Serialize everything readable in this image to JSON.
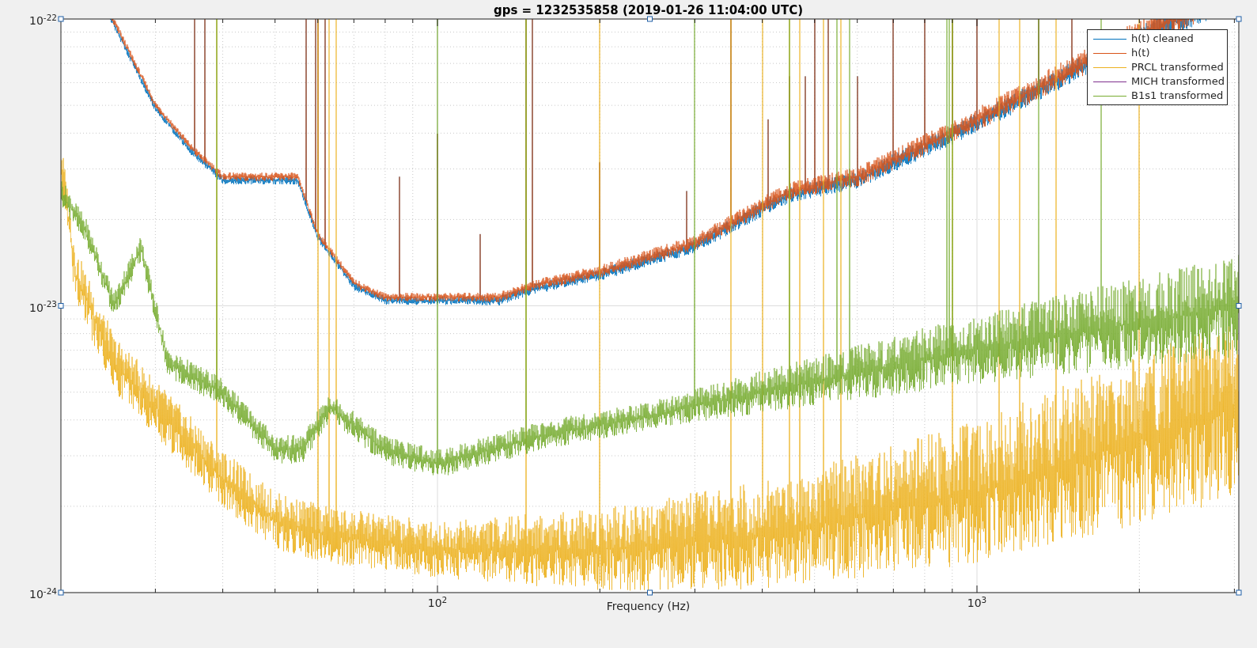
{
  "figure": {
    "title": "gps = 1232535858 (2019-01-26 11:04:00 UTC)",
    "xlabel": "Frequency (Hz)",
    "yticks": [
      "10$^{-22}$",
      "10$^{-23}$",
      "10$^{-24}$"
    ],
    "xticks": [
      "10$^{2}$",
      "10$^{3}$"
    ],
    "legend": [
      {
        "label": "h(t) cleaned",
        "color": "#0072bd"
      },
      {
        "label": "h(t)",
        "color": "#d95319"
      },
      {
        "label": "PRCL transformed",
        "color": "#edb120"
      },
      {
        "label": "MICH transformed",
        "color": "#7e2f8e"
      },
      {
        "label": "B1s1 transformed",
        "color": "#77ac30"
      }
    ]
  }
}
